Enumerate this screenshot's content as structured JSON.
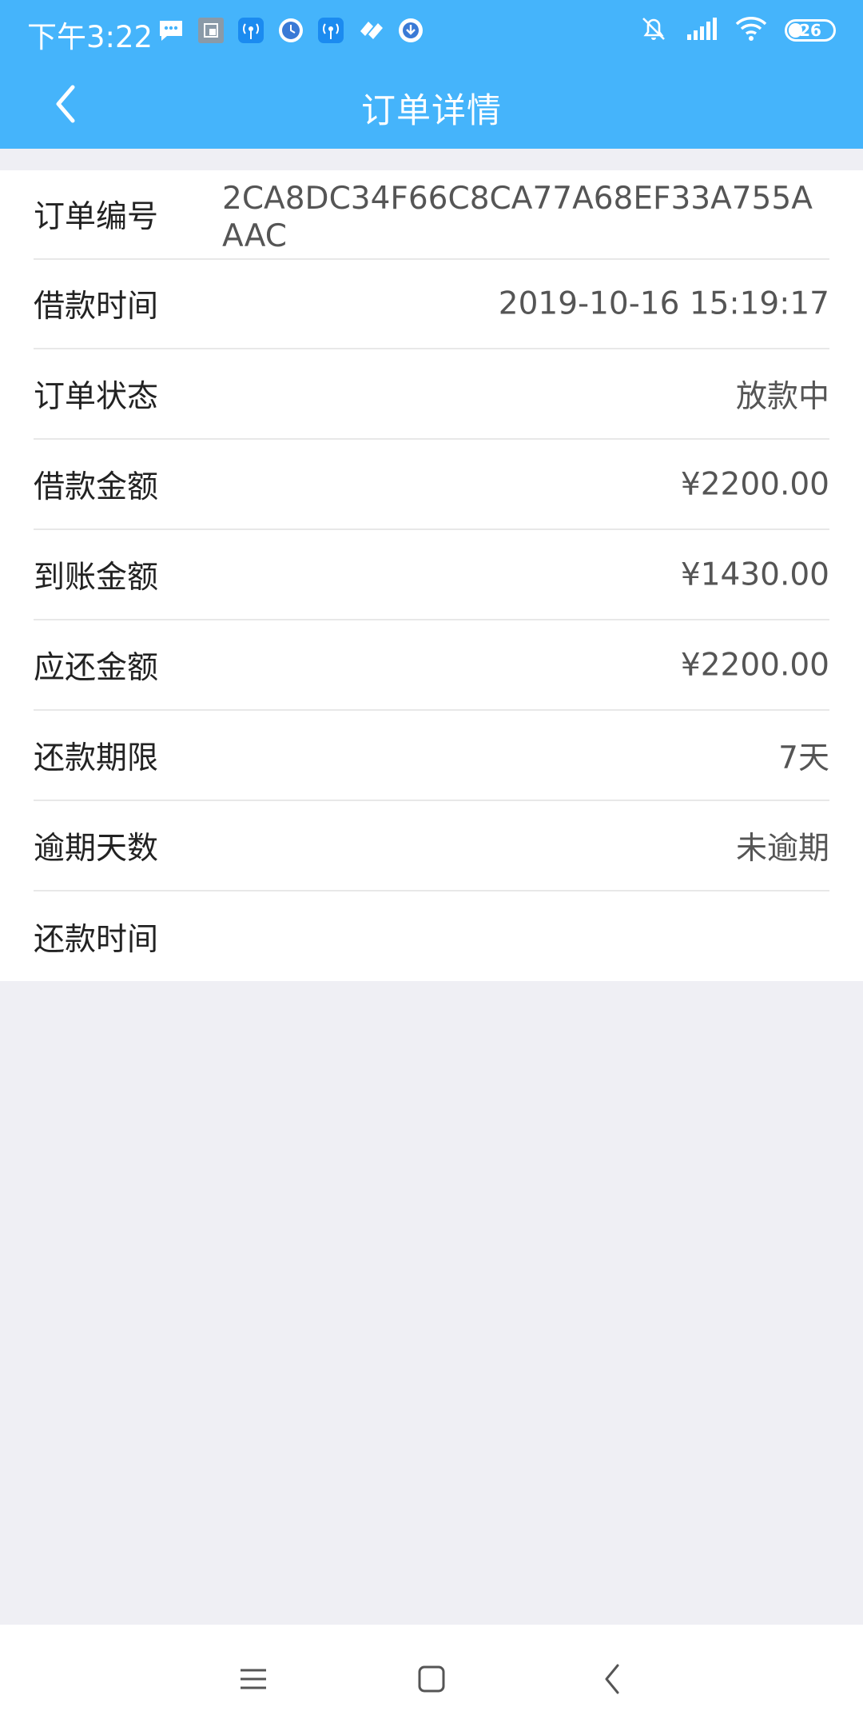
{
  "status_bar": {
    "time": "下午3:22",
    "battery": "26",
    "notification_icons": [
      "message-icon",
      "screenshot-icon",
      "hotspot-icon",
      "clock-icon",
      "hotspot-icon",
      "app-icon",
      "download-icon"
    ],
    "system_icons": [
      "mute-icon",
      "signal-icon",
      "wifi-icon",
      "battery-icon"
    ]
  },
  "header": {
    "title": "订单详情",
    "accent_color": "#45b4fb"
  },
  "details": {
    "rows": [
      {
        "label": "订单编号",
        "value": "2CA8DC34F66C8CA77A68EF33A755AAAC"
      },
      {
        "label": "借款时间",
        "value": "2019-10-16 15:19:17"
      },
      {
        "label": "订单状态",
        "value": "放款中"
      },
      {
        "label": "借款金额",
        "value": "¥2200.00"
      },
      {
        "label": "到账金额",
        "value": "¥1430.00"
      },
      {
        "label": "应还金额",
        "value": "¥2200.00"
      },
      {
        "label": "还款期限",
        "value": "7天"
      },
      {
        "label": "逾期天数",
        "value": "未逾期"
      },
      {
        "label": "还款时间",
        "value": ""
      }
    ]
  },
  "bottom_nav": {
    "buttons": [
      "menu-icon",
      "home-icon",
      "back-icon"
    ]
  }
}
